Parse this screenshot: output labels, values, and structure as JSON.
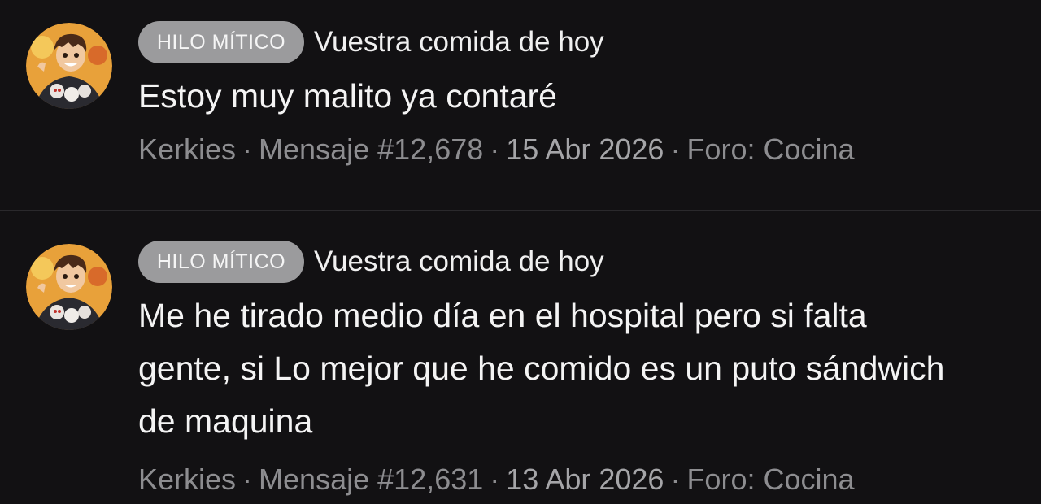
{
  "posts": [
    {
      "badge": "HILO MÍTICO",
      "thread_title": "Vuestra comida de hoy",
      "body": "Estoy muy malito ya contaré",
      "author": "Kerkies",
      "message": "Mensaje #12,678",
      "date": "15 Abr 2026",
      "forum": "Foro: Cocina",
      "avatar_icon": "cartoon-avatar-icon"
    },
    {
      "badge": "HILO MÍTICO",
      "thread_title": "Vuestra comida de hoy",
      "body": "Me he tirado medio día en el hospital pero si falta gente, si Lo mejor que he comido es un puto sándwich de maquina",
      "author": "Kerkies",
      "message": "Mensaje #12,631",
      "date": "13 Abr 2026",
      "forum": "Foro: Cocina",
      "avatar_icon": "cartoon-avatar-icon"
    }
  ],
  "meta_separator": "·",
  "colors": {
    "background": "#121113",
    "badge_bg": "#9b9b9d",
    "meta_text": "#8d8d90"
  }
}
